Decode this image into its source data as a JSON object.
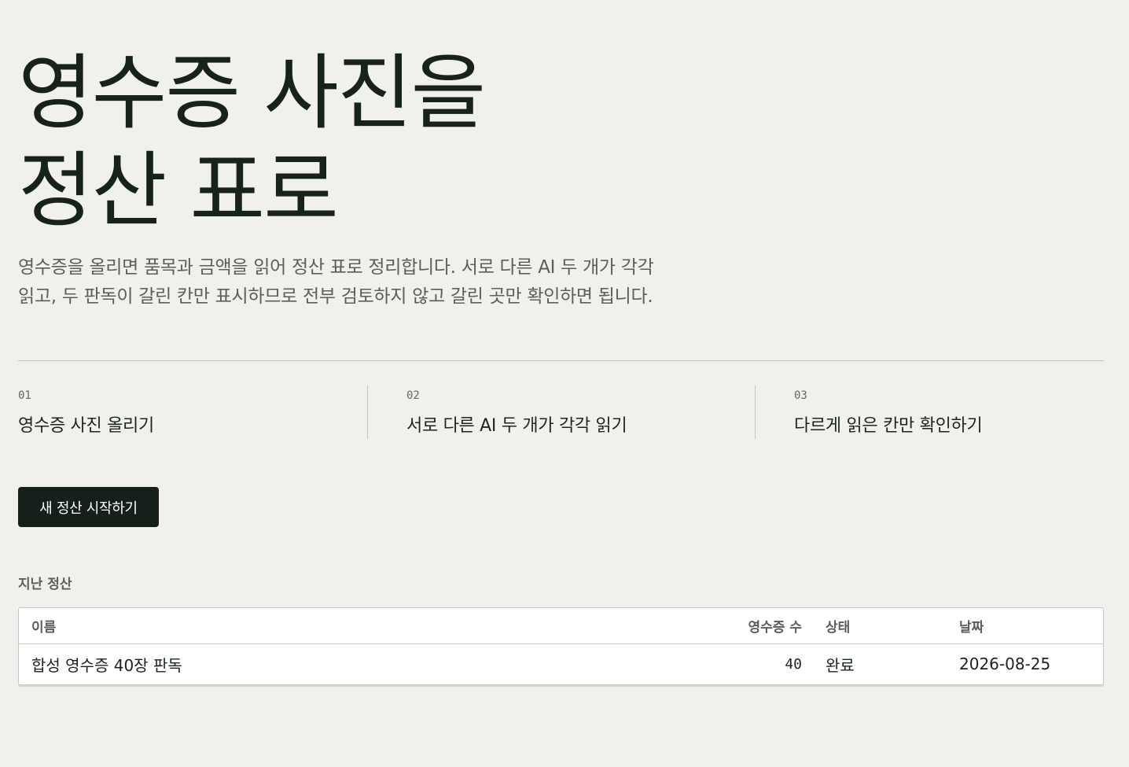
{
  "hero": {
    "title_line1": "영수증 사진을",
    "title_line2": "정산 표로",
    "intro_line1": "영수증을 올리면 품목과 금액을 읽어 정산 표로 정리합니다. 서로 다른 AI 두 개가 각각",
    "intro_line2": "읽고, 두 판독이 갈린 칸만 표시하므로 전부 검토하지 않고 갈린 곳만 확인하면 됩니다."
  },
  "steps": [
    {
      "number": "01",
      "label": "영수증 사진 올리기"
    },
    {
      "number": "02",
      "label": "서로 다른 AI 두 개가 각각 읽기"
    },
    {
      "number": "03",
      "label": "다르게 읽은 칸만 확인하기"
    }
  ],
  "actions": {
    "start_label": "새 정산 시작하기"
  },
  "history": {
    "section_label": "지난 정산",
    "columns": {
      "name": "이름",
      "count": "영수증 수",
      "status": "상태",
      "date": "날짜"
    },
    "rows": [
      {
        "name": "합성 영수증 40장 판독",
        "count": "40",
        "status": "완료",
        "date": "2026-08-25"
      }
    ]
  },
  "colors": {
    "background": "#f0f0ec",
    "text_primary": "#17221c",
    "text_muted": "#5a5f5c",
    "button_bg": "#15201b",
    "button_text": "#ffffff",
    "divider": "#bfc2bd"
  }
}
